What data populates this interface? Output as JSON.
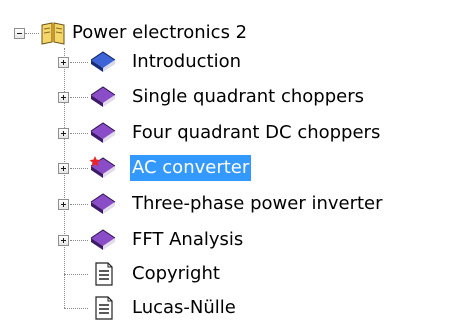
{
  "tree": {
    "root": {
      "label": "Power electronics 2",
      "icon": "open-book-icon",
      "expanded": true
    },
    "children": [
      {
        "label": "Introduction",
        "icon": "blue-book-icon",
        "expandable": true,
        "selected": false
      },
      {
        "label": "Single quadrant choppers",
        "icon": "purple-book-icon",
        "expandable": true,
        "selected": false
      },
      {
        "label": "Four quadrant DC choppers",
        "icon": "purple-book-icon",
        "expandable": true,
        "selected": false
      },
      {
        "label": "AC converter",
        "icon": "purple-book-red-mark-icon",
        "expandable": true,
        "selected": true
      },
      {
        "label": "Three-phase power inverter",
        "icon": "purple-book-icon",
        "expandable": true,
        "selected": false
      },
      {
        "label": "FFT Analysis",
        "icon": "purple-book-icon",
        "expandable": true,
        "selected": false
      },
      {
        "label": "Copyright",
        "icon": "document-icon",
        "expandable": false,
        "selected": false
      },
      {
        "label": "Lucas-Nülle",
        "icon": "document-icon",
        "expandable": false,
        "selected": false
      }
    ]
  },
  "colors": {
    "selection": "#3399ff",
    "blue_book": "#1f3f9e",
    "purple_book": "#5c2e91",
    "mark": "#e8252a"
  }
}
